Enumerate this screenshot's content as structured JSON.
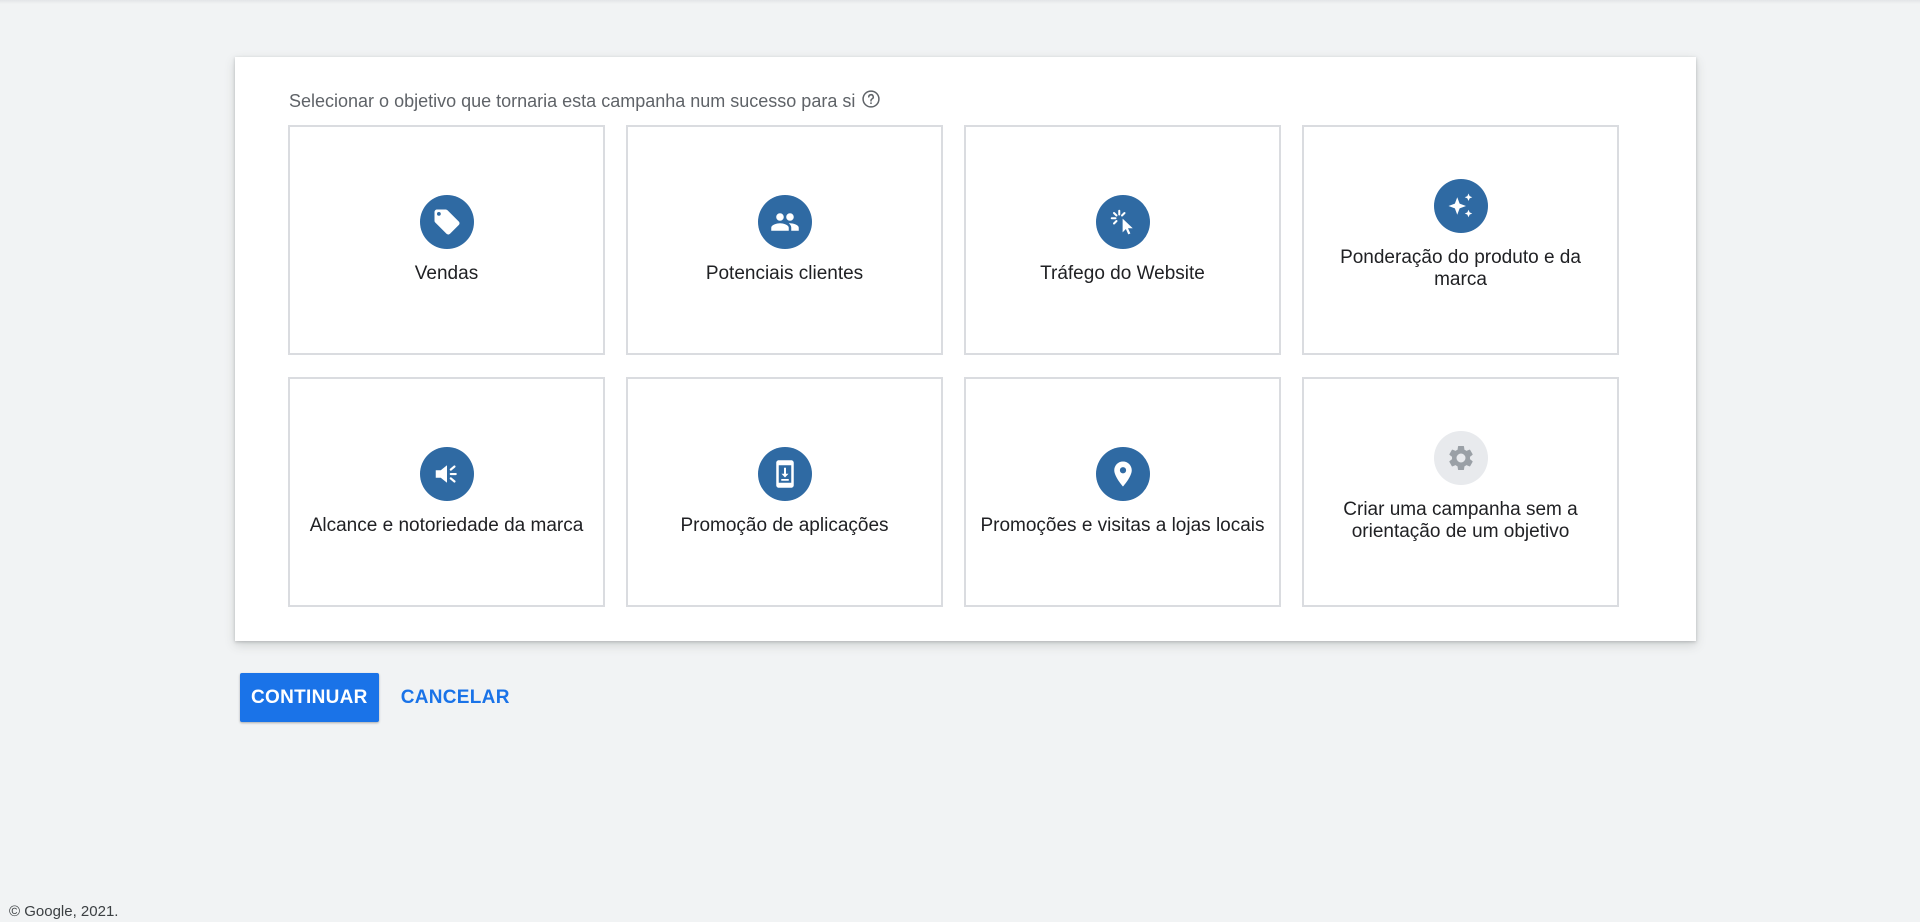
{
  "prompt": {
    "text": "Selecionar o objetivo que tornaria esta campanha num sucesso para si",
    "help_icon": "help-circle-icon"
  },
  "objectives": [
    {
      "label": "Vendas",
      "icon": "sales-tag-icon"
    },
    {
      "label": "Potenciais clientes",
      "icon": "people-icon"
    },
    {
      "label": "Tráfego do Website",
      "icon": "click-cursor-icon"
    },
    {
      "label": "Ponderação do produto e da marca",
      "icon": "sparkle-icon"
    },
    {
      "label": "Alcance e notoriedade da marca",
      "icon": "megaphone-icon"
    },
    {
      "label": "Promoção de aplicações",
      "icon": "app-download-icon"
    },
    {
      "label": "Promoções e visitas a lojas locais",
      "icon": "location-pin-icon"
    },
    {
      "label": "Criar uma campanha sem a orientação de um objetivo",
      "icon": "gear-icon"
    }
  ],
  "actions": {
    "continue_label": "CONTINUAR",
    "cancel_label": "CANCELAR"
  },
  "footer": {
    "copyright": "© Google, 2021."
  },
  "colors": {
    "background": "#f1f3f4",
    "icon_circle": "#2f6aa3",
    "icon_circle_disabled": "#e8eaed",
    "primary": "#1a73e8"
  }
}
